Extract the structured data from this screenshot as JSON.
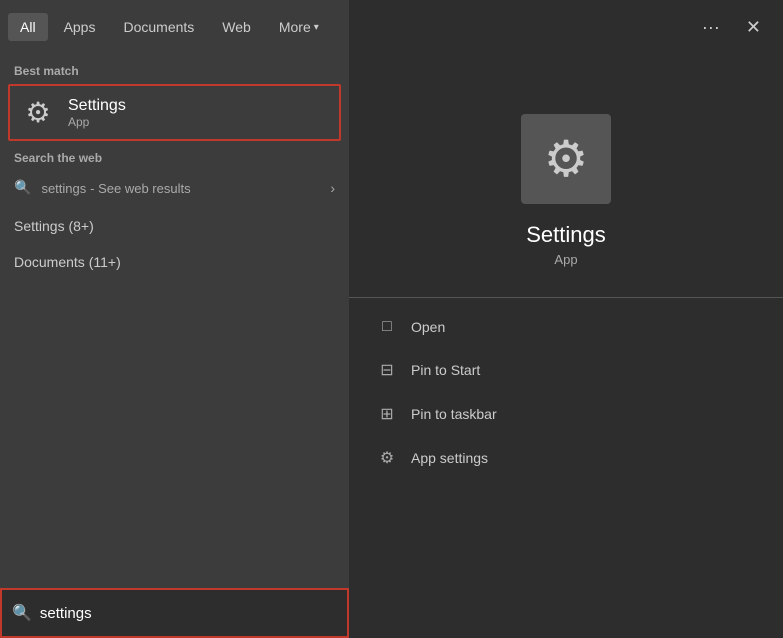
{
  "tabs": {
    "all": "All",
    "apps": "Apps",
    "documents": "Documents",
    "web": "Web",
    "more": "More"
  },
  "best_match": {
    "section_label": "Best match",
    "item_name": "Settings",
    "item_type": "App"
  },
  "web_search": {
    "section_label": "Search the web",
    "query": "settings",
    "see_results": "- See web results"
  },
  "categories": [
    {
      "label": "Settings (8+)"
    },
    {
      "label": "Documents (11+)"
    }
  ],
  "right_panel": {
    "app_name": "Settings",
    "app_type": "App"
  },
  "context_menu": {
    "open": "Open",
    "pin_to_start": "Pin to Start",
    "pin_to_taskbar": "Pin to taskbar",
    "app_settings": "App settings"
  },
  "search_box": {
    "value": "settings",
    "placeholder": "settings"
  },
  "icons": {
    "gear": "⚙",
    "search": "🔍",
    "three_dots": "···",
    "close": "✕",
    "chevron_right": "›",
    "chevron_down": "⌄",
    "pin": "📌",
    "taskbar": "⊞",
    "settings_gear": "⚙",
    "open_box": "□"
  }
}
